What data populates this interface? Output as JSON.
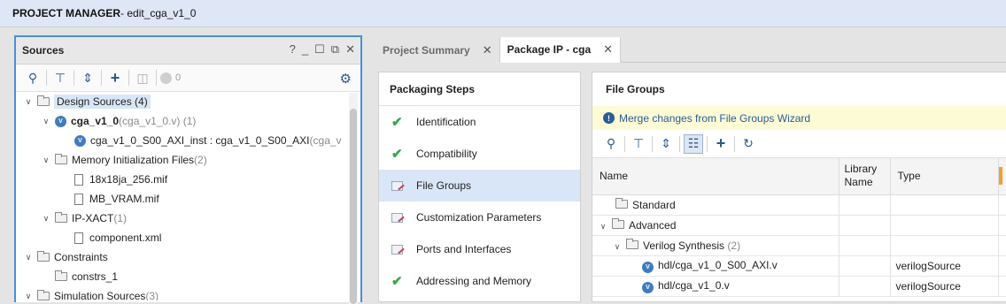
{
  "window": {
    "title_bold": "PROJECT MANAGER",
    "title_rest": " - edit_cga_v1_0"
  },
  "sources": {
    "title": "Sources",
    "controls": [
      "?",
      "_",
      "☐",
      "⧉",
      "✕"
    ],
    "badge_count": "0",
    "tree": [
      {
        "label": "Design Sources",
        "suffix": " (4)",
        "level": 0
      },
      {
        "label": "cga_v1_0",
        "suffix": " (cga_v1_0.v) (1)",
        "level": 1
      },
      {
        "label": "cga_v1_0_S00_AXI_inst : cga_v1_0_S00_AXI",
        "suffix": " (cga_v",
        "level": 2
      },
      {
        "label": "Memory Initialization Files",
        "suffix": " (2)",
        "level": 1
      },
      {
        "label": "18x18ja_256.mif",
        "level": 2
      },
      {
        "label": "MB_VRAM.mif",
        "level": 2
      },
      {
        "label": "IP-XACT",
        "suffix": " (1)",
        "level": 1
      },
      {
        "label": "component.xml",
        "level": 2
      },
      {
        "label": "Constraints",
        "level": 0
      },
      {
        "label": "constrs_1",
        "level": 1
      },
      {
        "label": "Simulation Sources",
        "suffix": " (3)",
        "level": 0
      }
    ]
  },
  "tabs": [
    {
      "label": "Project Summary"
    },
    {
      "label": "Package IP - cga"
    }
  ],
  "steps": {
    "title": "Packaging Steps",
    "items": [
      {
        "label": "Identification",
        "status": "done"
      },
      {
        "label": "Compatibility",
        "status": "done"
      },
      {
        "label": "File Groups",
        "status": "edited"
      },
      {
        "label": "Customization Parameters",
        "status": "edited"
      },
      {
        "label": "Ports and Interfaces",
        "status": "edited"
      },
      {
        "label": "Addressing and Memory",
        "status": "done"
      }
    ]
  },
  "file_groups": {
    "title": "File Groups",
    "banner": "Merge changes from File Groups Wizard",
    "columns": [
      "Name",
      "Library\nName",
      "Type"
    ],
    "rows": [
      {
        "name": "Standard",
        "library": "",
        "type": ""
      },
      {
        "name": "Advanced",
        "library": "",
        "type": ""
      },
      {
        "name": "Verilog Synthesis",
        "suffix": " (2)",
        "library": "",
        "type": ""
      },
      {
        "name": "hdl/cga_v1_0_S00_AXI.v",
        "library": "",
        "type": "verilogSource"
      },
      {
        "name": "hdl/cga_v1_0.v",
        "library": "",
        "type": "verilogSource"
      }
    ]
  }
}
